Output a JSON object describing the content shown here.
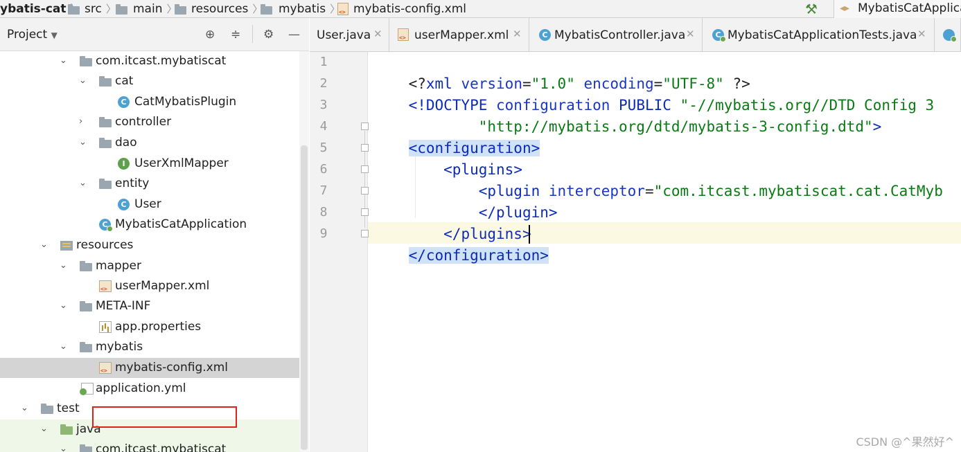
{
  "breadcrumb": {
    "items": [
      {
        "label": "ybatis-cat"
      },
      {
        "label": "src"
      },
      {
        "label": "main"
      },
      {
        "label": "resources"
      },
      {
        "label": "mybatis"
      },
      {
        "label": "mybatis-config.xml"
      }
    ],
    "run_config": "MybatisCatApplica"
  },
  "project_panel": {
    "title": "Project",
    "tree": [
      {
        "label": "com.itcast.mybatiscat",
        "icon": "folder-icon",
        "expanded": true
      },
      {
        "label": "cat",
        "icon": "folder-icon",
        "expanded": true
      },
      {
        "label": "CatMybatisPlugin",
        "icon": "class-icon",
        "badge": "C"
      },
      {
        "label": "controller",
        "icon": "folder-icon",
        "expanded": false
      },
      {
        "label": "dao",
        "icon": "folder-icon",
        "expanded": true
      },
      {
        "label": "UserXmlMapper",
        "icon": "interface-icon",
        "badge": "I"
      },
      {
        "label": "entity",
        "icon": "folder-icon",
        "expanded": true
      },
      {
        "label": "User",
        "icon": "class-icon",
        "badge": "C"
      },
      {
        "label": "MybatisCatApplication",
        "icon": "spring-app-icon",
        "badge": "C"
      },
      {
        "label": "resources",
        "icon": "resources-folder-icon",
        "expanded": true
      },
      {
        "label": "mapper",
        "icon": "folder-icon",
        "expanded": true
      },
      {
        "label": "userMapper.xml",
        "icon": "xml-file-icon"
      },
      {
        "label": "META-INF",
        "icon": "folder-icon",
        "expanded": true
      },
      {
        "label": "app.properties",
        "icon": "properties-file-icon"
      },
      {
        "label": "mybatis",
        "icon": "folder-icon",
        "expanded": true
      },
      {
        "label": "mybatis-config.xml",
        "icon": "xml-file-icon",
        "selected": true
      },
      {
        "label": "application.yml",
        "icon": "yml-file-icon"
      },
      {
        "label": "test",
        "icon": "folder-icon",
        "expanded": true
      },
      {
        "label": "java",
        "icon": "test-source-folder-icon",
        "expanded": true
      },
      {
        "label": "com.itcast.mybatiscat",
        "icon": "folder-icon",
        "expanded": true
      }
    ]
  },
  "tabs": [
    {
      "label": "User.java",
      "icon": "class-icon"
    },
    {
      "label": "userMapper.xml",
      "icon": "xml-file-icon"
    },
    {
      "label": "MybatisController.java",
      "icon": "class-icon",
      "badge": "C"
    },
    {
      "label": "MybatisCatApplicationTests.java",
      "icon": "test-class-icon",
      "badge": "C"
    }
  ],
  "editor": {
    "line_numbers": [
      "1",
      "2",
      "3",
      "4",
      "5",
      "6",
      "7",
      "8",
      "9"
    ],
    "code": {
      "l1": {
        "a": "<?",
        "b": "xml",
        "c": " version",
        "d": "=",
        "e": "\"1.0\"",
        "f": " encoding",
        "g": "=",
        "h": "\"UTF-8\"",
        "i": " ?>"
      },
      "l2": {
        "a": "<!DOCTYPE",
        "b": " configuration",
        "c": " PUBLIC",
        "d": " \"-//mybatis.org//DTD Config 3"
      },
      "l3": {
        "a": "        \"http://mybatis.org/dtd/mybatis-3-config.dtd\"",
        "b": ">"
      },
      "l4": {
        "a": "<configuration>"
      },
      "l5": {
        "a": "    <",
        "b": "plugins",
        "c": ">"
      },
      "l6": {
        "a": "        <",
        "b": "plugin",
        "c": " interceptor",
        "d": "=",
        "e": "\"com.itcast.mybatiscat.cat.CatMyb"
      },
      "l7": {
        "a": "        </",
        "b": "plugin",
        "c": ">"
      },
      "l8": {
        "a": "    </",
        "b": "plugins",
        "c": ">"
      },
      "l9": {
        "a": "</configuration>"
      }
    }
  },
  "watermark": "CSDN @^果然好^",
  "colors": {
    "tag": "#0b2bb8",
    "string": "#0a7a14",
    "selection": "#cfe2f8",
    "highlight_box": "#e02020"
  }
}
